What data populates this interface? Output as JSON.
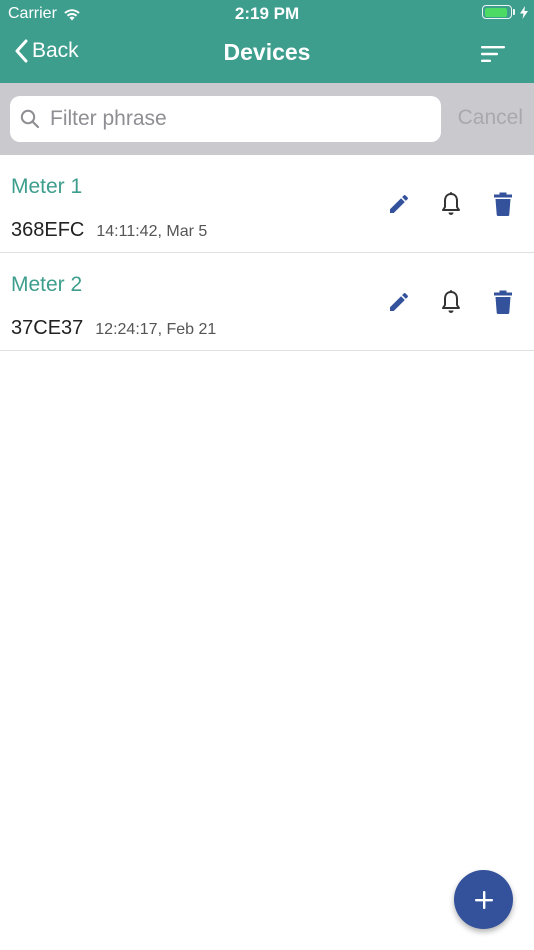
{
  "status_bar": {
    "carrier": "Carrier",
    "time": "2:19 PM",
    "battery_level": 0.9
  },
  "nav": {
    "back_label": "Back",
    "title": "Devices"
  },
  "search": {
    "placeholder": "Filter phrase",
    "value": "",
    "cancel_label": "Cancel"
  },
  "devices": [
    {
      "name": "Meter 1",
      "id": "368EFC",
      "timestamp": "14:11:42, Mar 5"
    },
    {
      "name": "Meter 2",
      "id": "37CE37",
      "timestamp": "12:24:17, Feb 21"
    }
  ],
  "icons": {
    "edit": "pencil-icon",
    "alarm": "bell-icon",
    "delete": "trash-icon",
    "add": "plus-icon",
    "sort": "sort-icon",
    "search": "search-icon",
    "back": "chevron-left-icon"
  },
  "colors": {
    "header": "#3e9e8d",
    "accent": "#34529b",
    "device_name": "#3e9e8d",
    "search_bar_bg": "#c9c9ce"
  }
}
